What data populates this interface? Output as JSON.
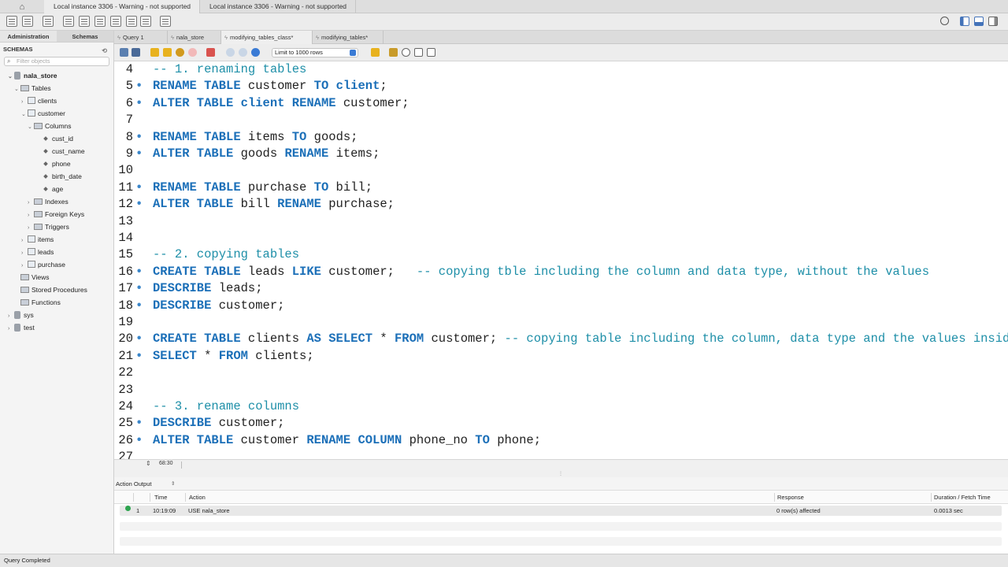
{
  "window": {
    "connection_tabs": [
      "Local instance 3306 - Warning - not supported",
      "Local instance 3306 - Warning - not supported"
    ]
  },
  "sidebar": {
    "tabs": [
      "Administration",
      "Schemas"
    ],
    "header": "SCHEMAS",
    "filter_placeholder": "Filter objects",
    "tree": [
      {
        "label": "nala_store"
      },
      {
        "label": "Tables"
      },
      {
        "label": "clients"
      },
      {
        "label": "customer"
      },
      {
        "label": "Columns"
      },
      {
        "label": "cust_id"
      },
      {
        "label": "cust_name"
      },
      {
        "label": "phone"
      },
      {
        "label": "birth_date"
      },
      {
        "label": "age"
      },
      {
        "label": "Indexes"
      },
      {
        "label": "Foreign Keys"
      },
      {
        "label": "Triggers"
      },
      {
        "label": "items"
      },
      {
        "label": "leads"
      },
      {
        "label": "purchase"
      },
      {
        "label": "Views"
      },
      {
        "label": "Stored Procedures"
      },
      {
        "label": "Functions"
      },
      {
        "label": "sys"
      },
      {
        "label": "test"
      }
    ]
  },
  "editor_tabs": [
    "Query 1",
    "nala_store",
    "modifying_tables_class*",
    "modifying_tables*"
  ],
  "editor_toolbar": {
    "limit_label": "Limit to 1000 rows"
  },
  "editor": {
    "cursor_position": "68:30"
  },
  "output": {
    "title": "Action Output",
    "columns": [
      "Time",
      "Action",
      "Response",
      "Duration / Fetch Time"
    ],
    "rows": [
      {
        "index": "1",
        "time": "10:19:09",
        "action": "USE nala_store",
        "response": "0 row(s) affected",
        "duration": "0.0013 sec"
      }
    ]
  },
  "status_bar": {
    "text": "Query Completed"
  },
  "colors": {
    "keyword": "#1b6fb8",
    "comment": "#1e8fa8",
    "success": "#2ea44f"
  }
}
